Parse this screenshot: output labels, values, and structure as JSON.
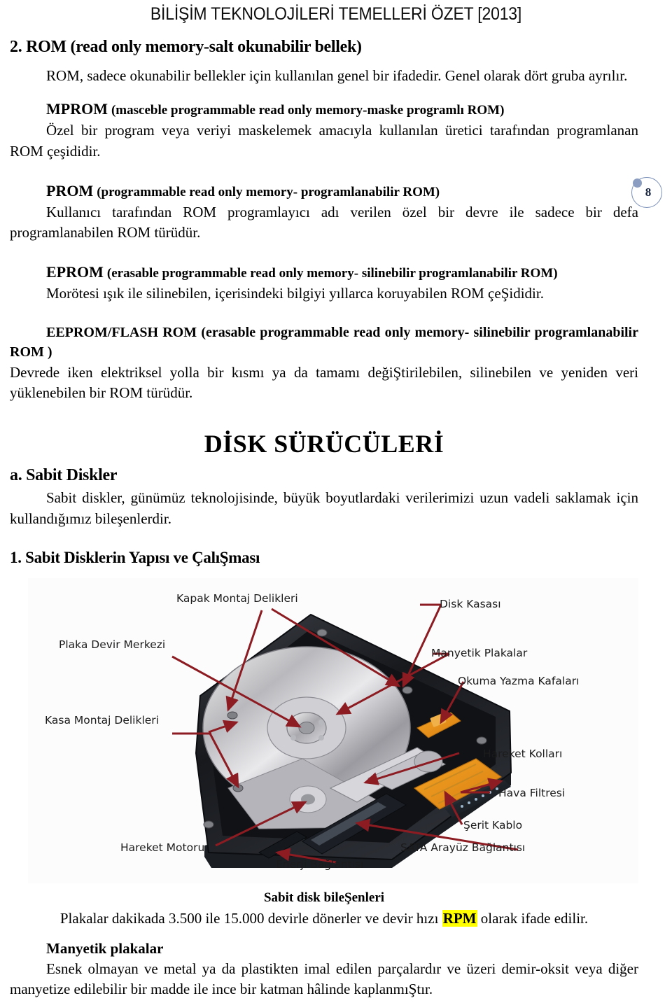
{
  "header": {
    "title": "BİLİŞİM TEKNOLOJİLERİ TEMELLERİ ÖZET [2013]"
  },
  "page_badge": {
    "number": "8"
  },
  "sections": {
    "rom_heading": "2. ROM (read only memory-salt okunabilir bellek)",
    "rom_intro": "ROM, sadece okunabilir bellekler için kullanılan genel bir ifadedir. Genel olarak dört gruba ayrılır.",
    "mprom_title_bold": "MPROM",
    "mprom_title_rest": "(masceble programmable read only memory-maske programlı ROM)",
    "mprom_body": "Özel bir program veya veriyi maskelemek amacıyla kullanılan üretici tarafından programlanan ROM çeşididir.",
    "prom_title_bold": "PROM",
    "prom_title_rest": "(programmable read only memory- programlanabilir ROM)",
    "prom_body": "Kullanıcı tarafından ROM programlayıcı adı verilen özel bir devre ile sadece bir defa programlanabilen ROM türüdür.",
    "eprom_title_bold": "EPROM",
    "eprom_title_rest": "(erasable programmable read only memory- silinebilir programlanabilir ROM)",
    "eprom_body": "Morötesi ışık ile silinebilen, içerisindeki bilgiyi yıllarca koruyabilen ROM çeŞididir.",
    "eeprom_title_bold": "EEPROM/FLASH ROM",
    "eeprom_title_rest": "(erasable programmable read only memory- silinebilir programlanabilir ROM )",
    "eeprom_body": "Devrede iken elektriksel yolla bir kısmı ya da tamamı değiŞtirilebilen, silinebilen ve yeniden veri yüklenebilen bir ROM türüdür."
  },
  "disk": {
    "big_title": "DİSK SÜRÜCÜLERİ",
    "heading_a": "a. Sabit Diskler",
    "intro": "Sabit diskler, günümüz teknolojisinde, büyük boyutlardaki verilerimizi uzun vadeli saklamak için kullandığımız bileşenlerdir.",
    "heading_1": "1. Sabit Disklerin Yapısı ve ÇalıŞması"
  },
  "figure": {
    "alt": "hard-disk-drive-photo",
    "labels": [
      {
        "id": "kapak-montaj-delikleri",
        "text": "Kapak Montaj Delikleri"
      },
      {
        "id": "plaka-devir-merkezi",
        "text": "Plaka Devir Merkezi"
      },
      {
        "id": "kasa-montaj-delikleri",
        "text": "Kasa Montaj Delikleri"
      },
      {
        "id": "disk-kasasi",
        "text": "Disk Kasası"
      },
      {
        "id": "manyetik-plakalar",
        "text": "Manyetik Plakalar"
      },
      {
        "id": "okuma-yazma-kafalari",
        "text": "Okuma Yazma Kafaları"
      },
      {
        "id": "hareket-kollari",
        "text": "Hareket Kolları"
      },
      {
        "id": "hava-filtresi",
        "text": "Hava Filtresi"
      },
      {
        "id": "serit-kablo",
        "text": "Şerit Kablo"
      },
      {
        "id": "hareket-motoru",
        "text": "Hareket Motoru"
      },
      {
        "id": "enerji-baglantisi",
        "text": "Enerji Bağlantısı"
      },
      {
        "id": "sata-arayuz-baglantisi",
        "text": "SATA Arayüz Bağlantısı"
      }
    ],
    "arrow_color": "#8c1c22"
  },
  "bottom": {
    "caption": "Sabit disk bileŞenleri",
    "rpm_line_before": "Plakalar dakikada 3.500 ile 15.000 devirle dönerler ve devir hızı ",
    "rpm_highlight": "RPM",
    "rpm_line_after": " olarak ifade edilir.",
    "manyetik_heading": "Manyetik plakalar",
    "manyetik_body": "Esnek olmayan ve metal ya da plastikten imal edilen parçalardır ve üzeri demir-oksit veya diğer manyetize edilebilir bir madde ile ince bir katman hâlinde kaplanmıŞtır."
  }
}
